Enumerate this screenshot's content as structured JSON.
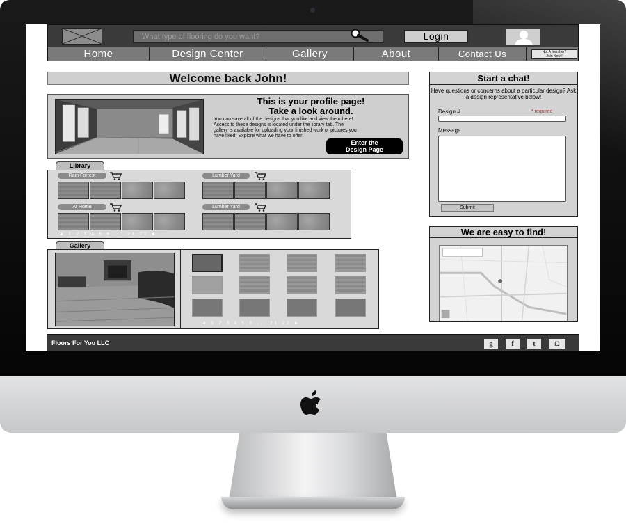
{
  "header": {
    "search_placeholder": "What type of flooring do you want?",
    "login_label": "Login"
  },
  "nav": {
    "items": [
      {
        "label": "Home"
      },
      {
        "label": "Design Center"
      },
      {
        "label": "Gallery"
      },
      {
        "label": "About"
      },
      {
        "label": "Contact Us"
      }
    ],
    "member_button": {
      "line1": "Not A Member?",
      "line2": "Join Now!!"
    }
  },
  "welcome": {
    "title": "Welcome back John!"
  },
  "profile": {
    "title_line1": "This is your profile page!",
    "title_line2": "Take a look around.",
    "body": "You can save all of the designs that you like and view them here! Access to these designs is located under the library tab. The gallery is available for uploading your finished work or pictures you have liked. Explore what we have to offer!",
    "button_line1": "Enter the",
    "button_line2": "Design Page"
  },
  "library": {
    "tab_label": "Library",
    "collections": [
      {
        "name": "Rain Forrest"
      },
      {
        "name": "Lumber Yard"
      },
      {
        "name": "At Home"
      },
      {
        "name": "Lumber Yard"
      }
    ],
    "pager": "◄ 1 2 3 4 5 6 ... 21 22 ►"
  },
  "gallery": {
    "tab_label": "Gallery",
    "pager": "◄ 1 2 3 4 5 6 ... 21 22 ►"
  },
  "chat": {
    "title": "Start a chat!",
    "description": "Have questions or concerns about a particular design? Ask a design representative below!",
    "design_label": "Design #",
    "required_label": "* required",
    "message_label": "Message",
    "submit_label": "Submit"
  },
  "map_panel": {
    "title": "We are easy to find!"
  },
  "footer": {
    "company": "Floors For You LLC",
    "social_icons": [
      "google-plus-icon",
      "facebook-icon",
      "twitter-icon",
      "instagram-icon"
    ],
    "social_glyphs": [
      "g",
      "f",
      "t",
      "◘"
    ]
  },
  "colors": {
    "bar_dark": "#3a3a3a",
    "nav_gray": "#7a7a7a",
    "panel_gray": "#cfcfcf",
    "required_red": "#e02020"
  }
}
